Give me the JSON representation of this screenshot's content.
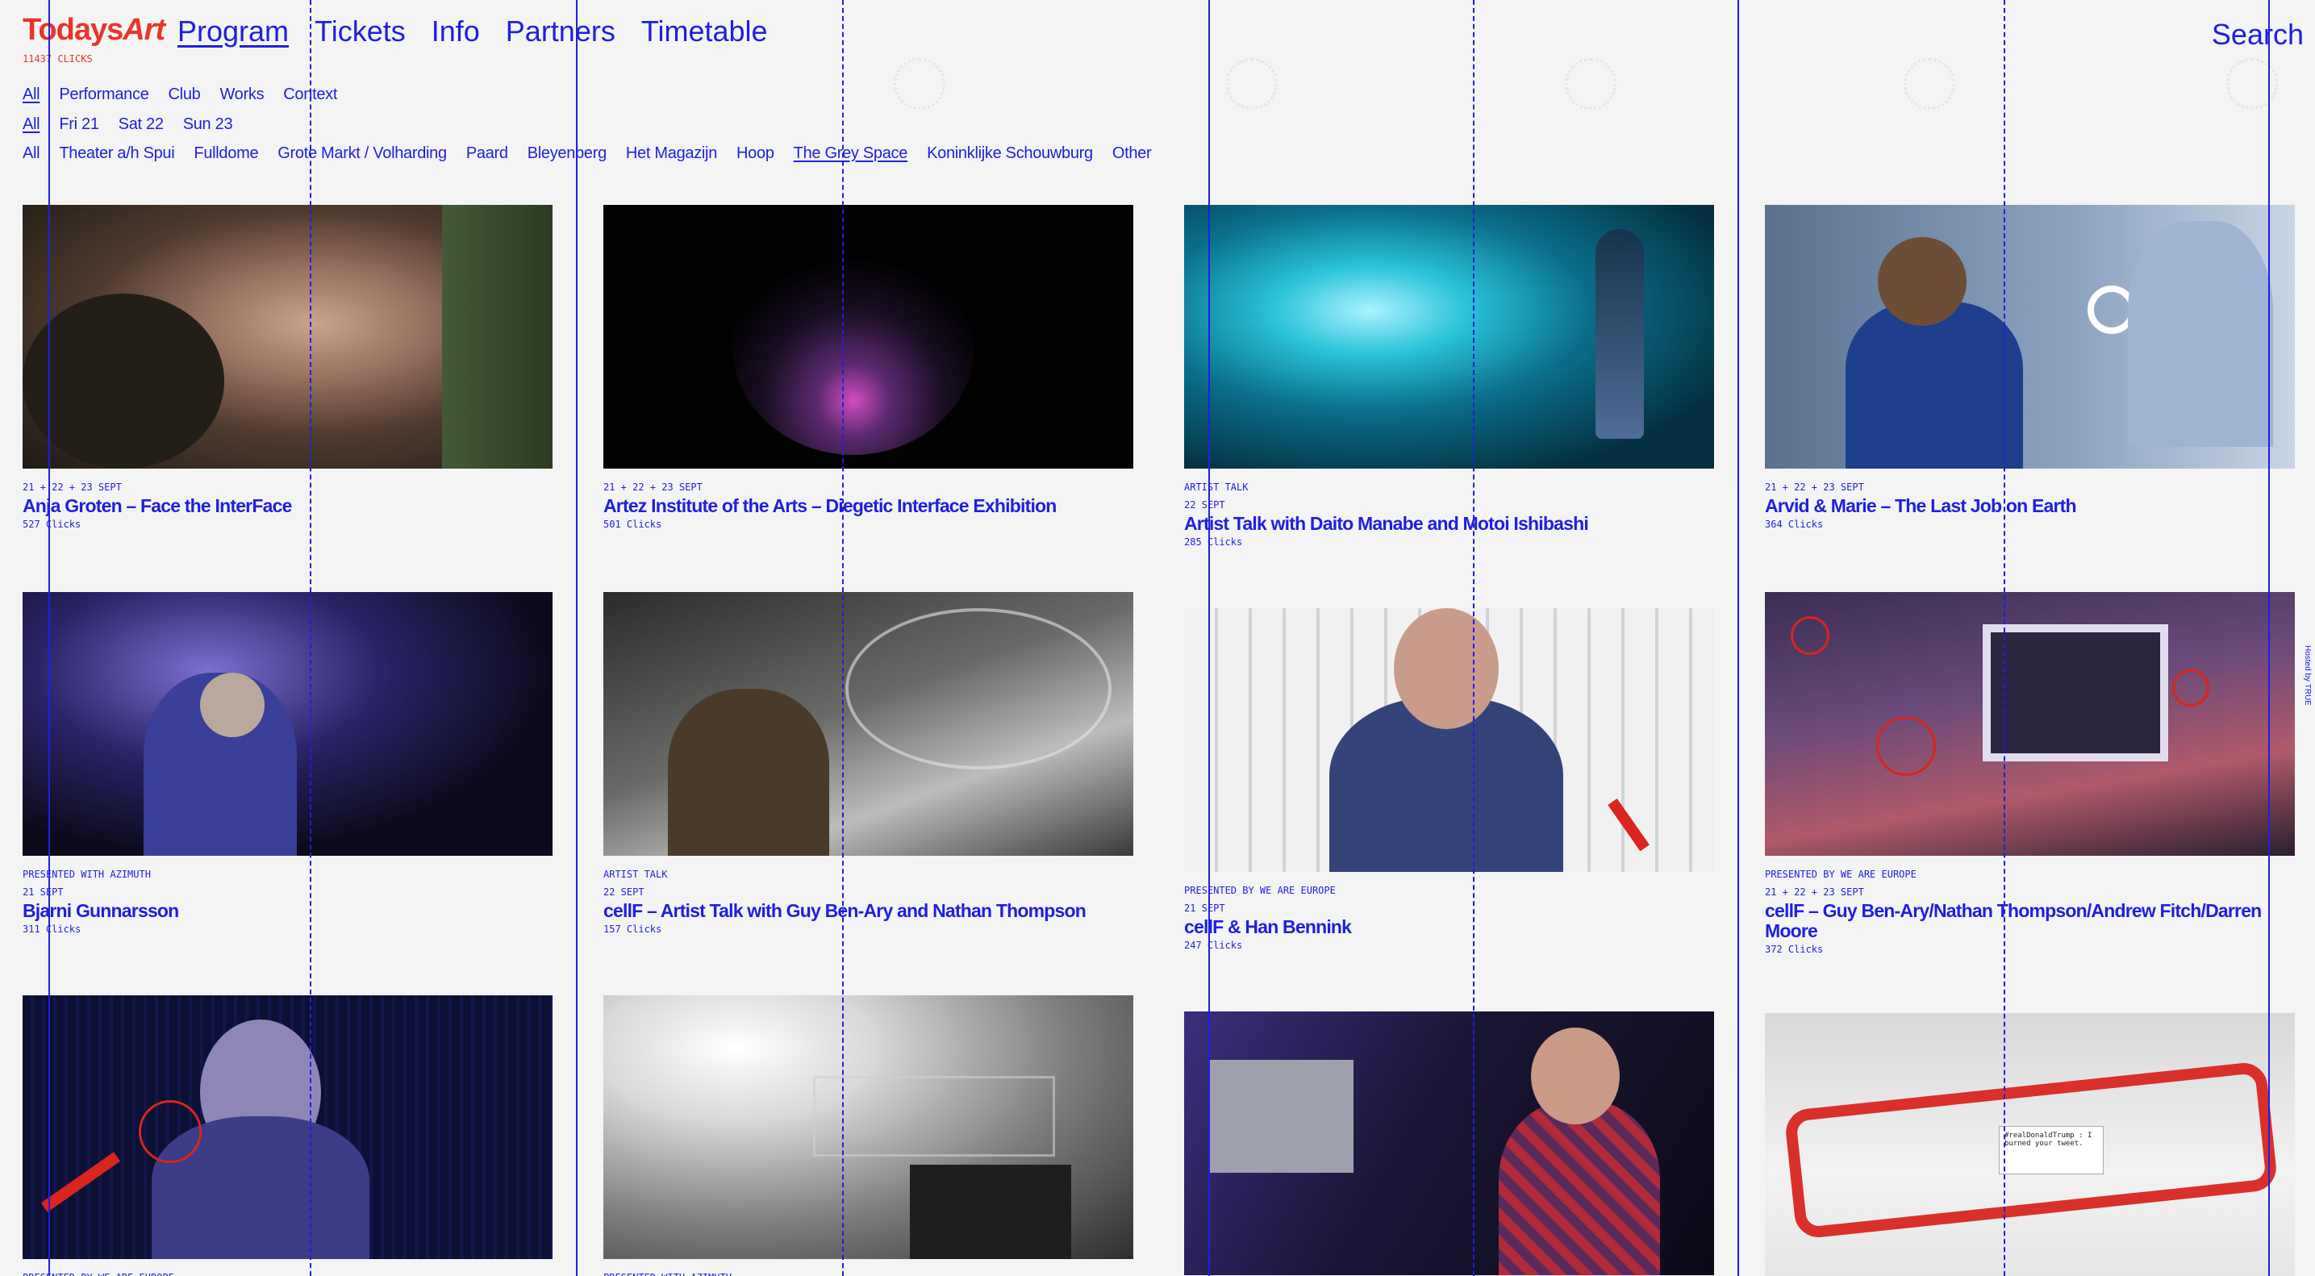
{
  "brand": {
    "name_a": "Todays",
    "name_b": "Art",
    "clicks": "11437 CLICKS"
  },
  "nav": {
    "items": [
      "Program",
      "Tickets",
      "Info",
      "Partners",
      "Timetable"
    ],
    "search": "Search"
  },
  "filters": {
    "categories": [
      "All",
      "Performance",
      "Club",
      "Works",
      "Context"
    ],
    "days": [
      "All",
      "Fri 21",
      "Sat 22",
      "Sun 23"
    ],
    "venues": [
      "All",
      "Theater a/h Spui",
      "Fulldome",
      "Grote Markt / Volharding",
      "Paard",
      "Bleyenberg",
      "Het Magazijn",
      "Hoop",
      "The Grey Space",
      "Koninklijke Schouwburg",
      "Other"
    ]
  },
  "side_label": "Hosted by TRUE",
  "events": [
    {
      "tag": "",
      "dates": "21 + 22 + 23 Sept",
      "title": "Anja Groten – Face the InterFace",
      "clicks": "527 Clicks",
      "image_icon": "portrait-photo"
    },
    {
      "tag": "",
      "dates": "21 + 22 + 23 Sept",
      "title": "Artez Institute of the Arts – Diegetic Interface Exhibition",
      "clicks": "501 Clicks",
      "image_icon": "glowing-sphere-photo"
    },
    {
      "tag": "Artist Talk",
      "dates": "22 Sept",
      "title": "Artist Talk with Daito Manabe and Motoi Ishibashi",
      "clicks": "285 Clicks",
      "image_icon": "light-performance-photo"
    },
    {
      "tag": "",
      "dates": "21 + 22 + 23 Sept",
      "title": "Arvid & Marie – The Last Job on Earth",
      "clicks": "364 Clicks",
      "image_icon": "job-interview-photo"
    },
    {
      "tag": "Presented with Azimuth",
      "dates": "21 Sept",
      "title": "Bjarni Gunnarsson",
      "clicks": "311 Clicks",
      "image_icon": "dj-photo"
    },
    {
      "tag": "Artist Talk",
      "dates": "22 Sept",
      "title": "cellF – Artist Talk with Guy Ben-Ary and Nathan Thompson",
      "clicks": "157 Clicks",
      "image_icon": "modular-synth-photo"
    },
    {
      "tag": "Presented by We Are Europe",
      "dates": "21 Sept",
      "title": "cellF & Han Bennink",
      "clicks": "247 Clicks",
      "image_icon": "drummer-portrait-photo"
    },
    {
      "tag": "Presented by We Are Europe",
      "dates": "21 + 22 + 23 Sept",
      "title": "cellF – Guy Ben-Ary/Nathan Thompson/Andrew Fitch/Darren Moore",
      "clicks": "372 Clicks",
      "image_icon": "installation-photo"
    },
    {
      "tag": "Presented by We Are Europe",
      "dates": "",
      "title": "",
      "clicks": "",
      "image_icon": "singer-photo"
    },
    {
      "tag": "Presented with Azimuth",
      "dates": "",
      "title": "",
      "clicks": "",
      "image_icon": "club-stage-photo"
    },
    {
      "tag": "",
      "dates": "",
      "title": "",
      "clicks": "",
      "image_icon": "musician-keyboard-photo"
    },
    {
      "tag": "",
      "dates": "",
      "title": "",
      "clicks": "",
      "image_icon": "robot-printer-photo",
      "printed_note": "#realDonaldTrump : I burned your tweet."
    }
  ]
}
